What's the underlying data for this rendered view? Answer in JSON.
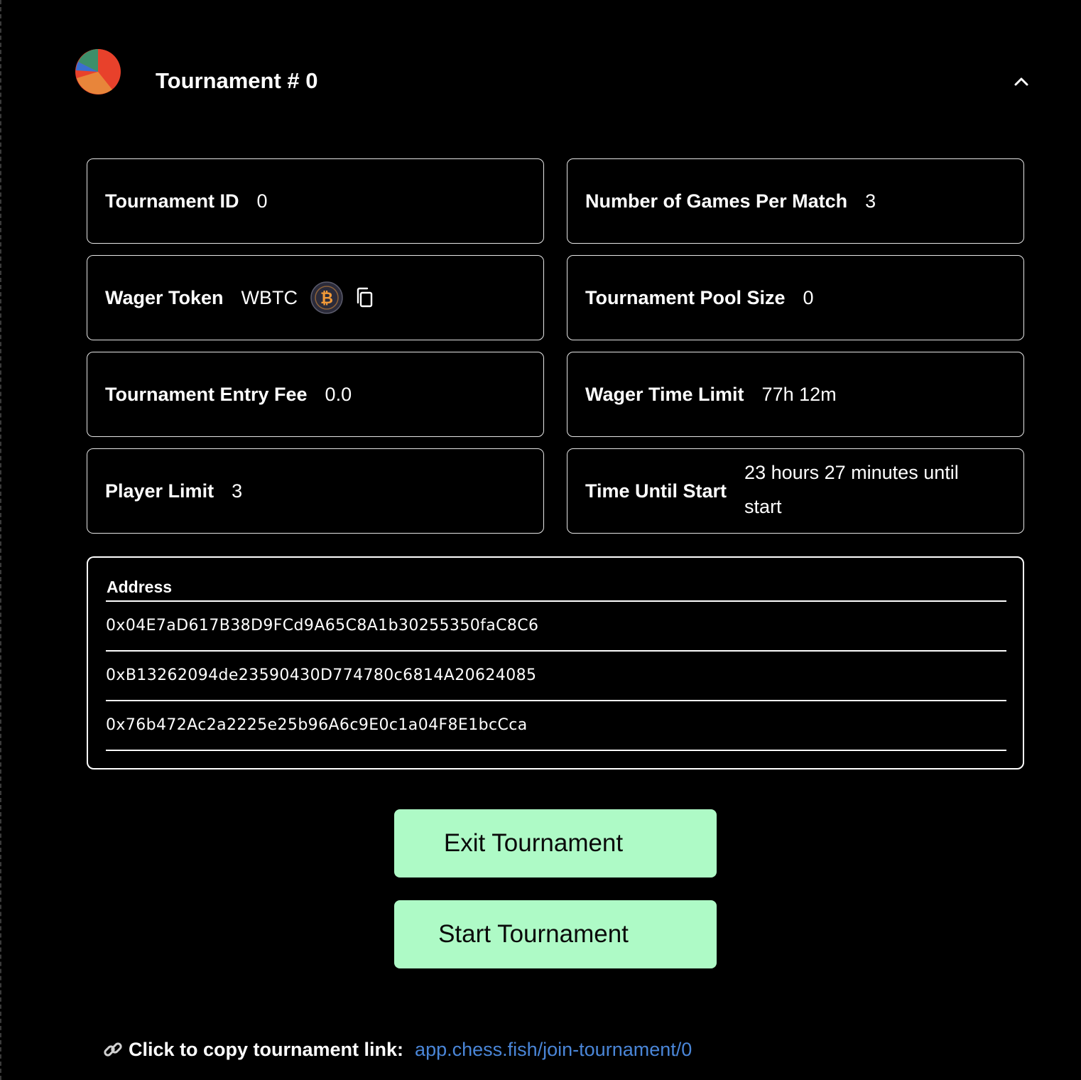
{
  "header": {
    "title": "Tournament # 0",
    "avatar_colors": [
      "#e8412b",
      "#e8853a",
      "#3d8f6a",
      "#3a6fd0"
    ]
  },
  "details": {
    "tournament_id": {
      "label": "Tournament ID",
      "value": "0"
    },
    "games_per_match": {
      "label": "Number of Games Per Match",
      "value": "3"
    },
    "wager_token": {
      "label": "Wager Token",
      "value": "WBTC",
      "token_icon": "bitcoin-icon",
      "copy_icon": "copy-icon"
    },
    "pool_size": {
      "label": "Tournament Pool Size",
      "value": "0"
    },
    "entry_fee": {
      "label": "Tournament Entry Fee",
      "value": "0.0"
    },
    "wager_time_limit": {
      "label": "Wager Time Limit",
      "value": "77h 12m"
    },
    "player_limit": {
      "label": "Player Limit",
      "value": "3"
    },
    "time_until_start": {
      "label": "Time Until Start",
      "value": "23 hours 27 minutes until start"
    }
  },
  "players": {
    "header": "Address",
    "addresses": [
      "0x04E7aD617B38D9FCd9A65C8A1b30255350faC8C6",
      "0xB13262094de23590430D774780c6814A20624085",
      "0x76b472Ac2a2225e25b96A6c9E0c1a04F8E1bcCca"
    ]
  },
  "actions": {
    "exit_label": "Exit Tournament",
    "start_label": "Start Tournament",
    "button_color": "#aefac6"
  },
  "footer": {
    "label": "Click to copy tournament link:",
    "link": "app.chess.fish/join-tournament/0",
    "link_color": "#4a86d8"
  }
}
